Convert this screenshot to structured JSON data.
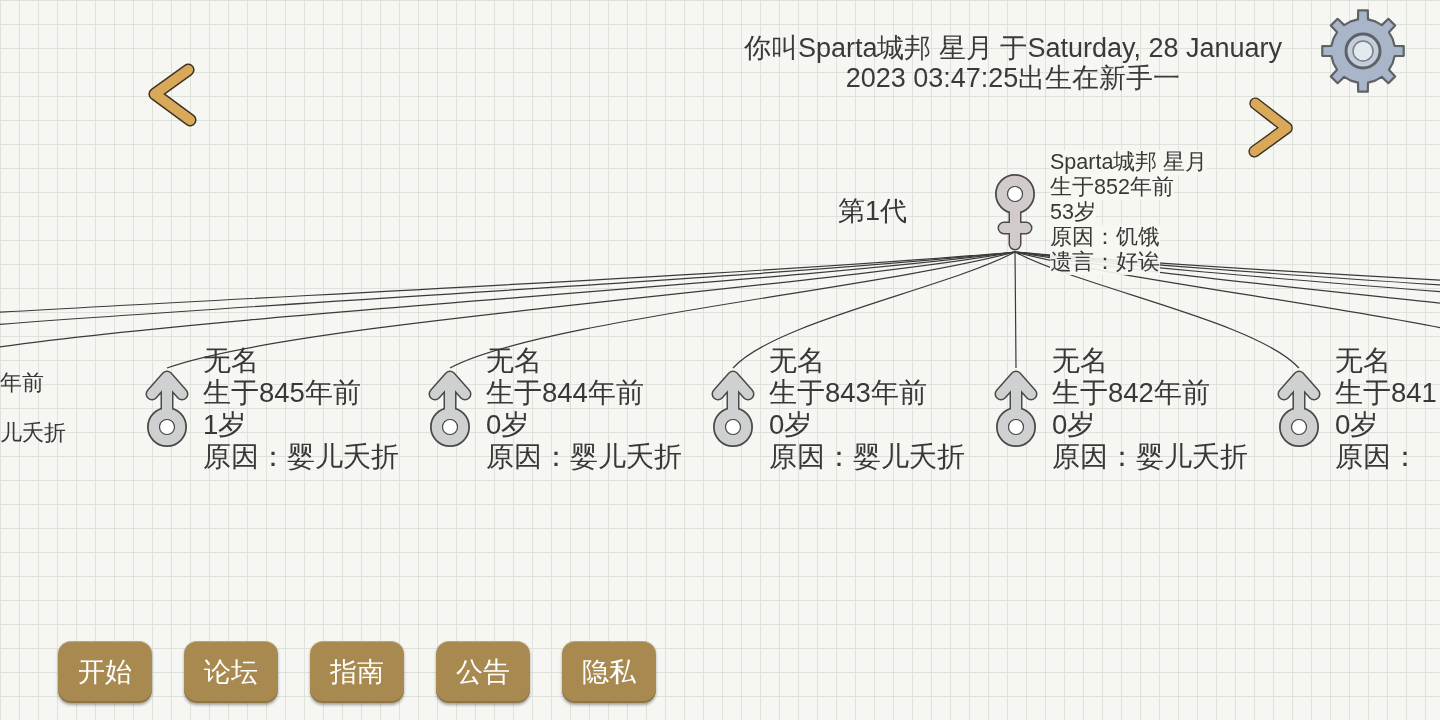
{
  "header": {
    "title": "你叫Sparta城邦 星月 于Saturday, 28 January 2023 03:47:25出生在新手一"
  },
  "tree": {
    "generation_label": "第1代",
    "root": {
      "kind": "female",
      "name": "Sparta城邦 星月",
      "born": "生于852年前",
      "age": "53岁",
      "cause": "原因：饥饿",
      "last_words": "遗言：好诶"
    },
    "children": [
      {
        "kind": "clipped",
        "born": "年前",
        "cause": "儿夭折"
      },
      {
        "kind": "male",
        "name": "无名",
        "born": "生于845年前",
        "age": "1岁",
        "cause": "原因：婴儿夭折"
      },
      {
        "kind": "male",
        "name": "无名",
        "born": "生于844年前",
        "age": "0岁",
        "cause": "原因：婴儿夭折"
      },
      {
        "kind": "male",
        "name": "无名",
        "born": "生于843年前",
        "age": "0岁",
        "cause": "原因：婴儿夭折"
      },
      {
        "kind": "male",
        "name": "无名",
        "born": "生于842年前",
        "age": "0岁",
        "cause": "原因：婴儿夭折"
      },
      {
        "kind": "male",
        "name": "无名",
        "born": "生于841",
        "age": "0岁",
        "cause": "原因："
      }
    ]
  },
  "buttons": [
    {
      "label": "开始"
    },
    {
      "label": "论坛"
    },
    {
      "label": "指南"
    },
    {
      "label": "公告"
    },
    {
      "label": "隐私"
    }
  ]
}
